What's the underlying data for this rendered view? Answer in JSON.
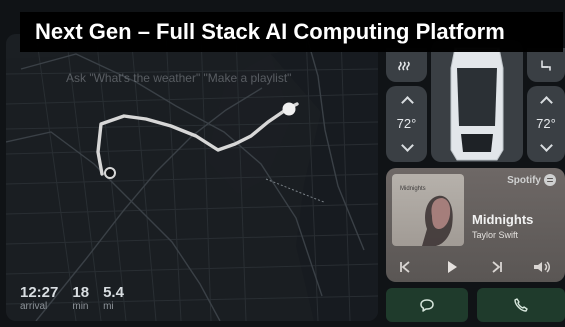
{
  "overlay": {
    "title": "Next Gen  – Full Stack AI Computing Platform"
  },
  "map": {
    "voice_hint": "Ask \"What's the weather\" \"Make a playlist\"",
    "eta": {
      "time": "12:27",
      "time_unit": "arrival",
      "minutes": "18",
      "minutes_unit": "min",
      "distance": "5.4",
      "distance_unit": "mi"
    }
  },
  "climate": {
    "left_temp": "72°",
    "right_temp": "72°",
    "left_seat_icon": "seat-heat-icon",
    "right_seat_icon": "seat-icon"
  },
  "media": {
    "service": "Spotify",
    "song": "Midnights",
    "artist": "Taylor Swift",
    "album_text": "Midnights"
  },
  "actions": {
    "message_icon": "message-icon",
    "phone_icon": "phone-icon"
  },
  "colors": {
    "background": "#101316",
    "route": "#d7d7d7",
    "button_green": "#1f3b2c",
    "panel": "#3a3f44"
  }
}
